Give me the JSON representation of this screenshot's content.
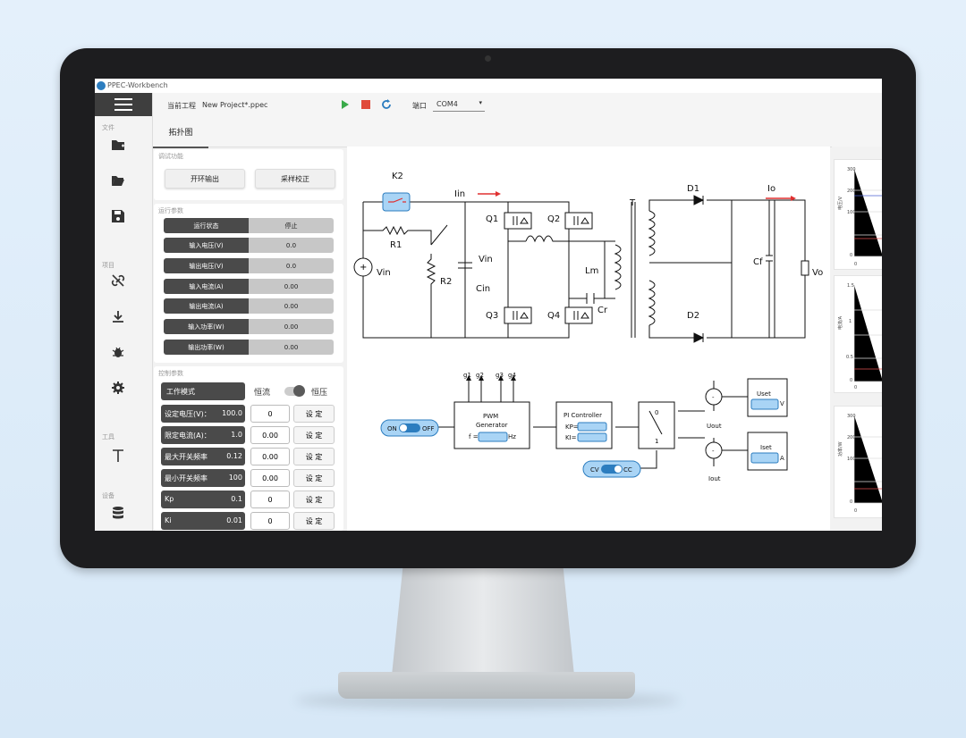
{
  "app": {
    "title": "PPEC-Workbench"
  },
  "topbar": {
    "project_label": "当前工程",
    "project_name": "New Project*.ppec",
    "port_label": "端口",
    "port_value": "COM4"
  },
  "tabs": [
    {
      "label": "拓扑图"
    }
  ],
  "sidebar": {
    "sections": [
      "文件",
      "项目",
      "工具",
      "设备"
    ]
  },
  "debug_panel": {
    "title": "调试功能",
    "open_loop_button": "开环输出",
    "calibrate_button": "采样校正"
  },
  "run_panel": {
    "title": "运行参数",
    "rows": [
      {
        "label": "运行状态",
        "value": "停止"
      },
      {
        "label": "输入电压(V)",
        "value": "0.0"
      },
      {
        "label": "输出电压(V)",
        "value": "0.0"
      },
      {
        "label": "输入电流(A)",
        "value": "0.00"
      },
      {
        "label": "输出电流(A)",
        "value": "0.00"
      },
      {
        "label": "输入功率(W)",
        "value": "0.00"
      },
      {
        "label": "输出功率(W)",
        "value": "0.00"
      }
    ]
  },
  "control_panel": {
    "title": "控制参数",
    "mode_label": "工作模式",
    "mode_left": "恒流",
    "mode_right": "恒压",
    "set_label": "设 定",
    "rows": [
      {
        "label": "设定电压(V)：",
        "value": "100.0",
        "input": "0"
      },
      {
        "label": "限定电流(A)：",
        "value": "1.0",
        "input": "0.00"
      },
      {
        "label": "最大开关频率",
        "value": "0.12",
        "input": "0.00"
      },
      {
        "label": "最小开关频率",
        "value": "100",
        "input": "0.00"
      },
      {
        "label": "Kp",
        "value": "0.1",
        "input": "0"
      },
      {
        "label": "Ki",
        "value": "0.01",
        "input": "0"
      }
    ]
  },
  "diagram": {
    "labels": {
      "k2": "K2",
      "iin": "Iin",
      "r1": "R1",
      "r2": "R2",
      "vin": "Vin",
      "vin_cap": "Vin",
      "cin": "Cin",
      "q1": "Q1",
      "q2": "Q2",
      "q3": "Q3",
      "q4": "Q4",
      "lm": "Lm",
      "cr": "Cr",
      "t": "T",
      "d1": "D1",
      "d2": "D2",
      "io": "Io",
      "cf": "Cf",
      "vo": "Vo"
    },
    "control": {
      "g1": "g1",
      "g2": "g2",
      "g3": "g3",
      "g4": "g4",
      "pwm_line1": "PWM",
      "pwm_line2": "Generator",
      "f": "f =",
      "hz": "Hz",
      "pi": "PI Controller",
      "kp": "KP=",
      "ki": "KI=",
      "sw0": "0",
      "sw1": "1",
      "on": "ON",
      "off": "OFF",
      "cv": "CV",
      "cc": "CC",
      "uset": "Uset",
      "v": "V",
      "iset": "Iset",
      "a": "A",
      "uout": "Uout",
      "iout": "Iout",
      "plus": "+",
      "minus": "-"
    }
  },
  "mini_charts": [
    {
      "ylabel": "电压/V",
      "ticks": [
        "300",
        "200",
        "100",
        "0"
      ],
      "xtick": "0"
    },
    {
      "ylabel": "电流/A",
      "ticks": [
        "1.5",
        "1",
        "0.5",
        "0"
      ],
      "xtick": "0"
    },
    {
      "ylabel": "功率/W",
      "ticks": [
        "300",
        "200",
        "100",
        "0"
      ],
      "xtick": "0"
    }
  ],
  "colors": {
    "accent_blue": "#2c7dbf",
    "toggle_fill": "#a9d4f5",
    "arrow_red": "#e03030",
    "line_blue": "#4a5fd0",
    "line_red": "#e05050"
  }
}
